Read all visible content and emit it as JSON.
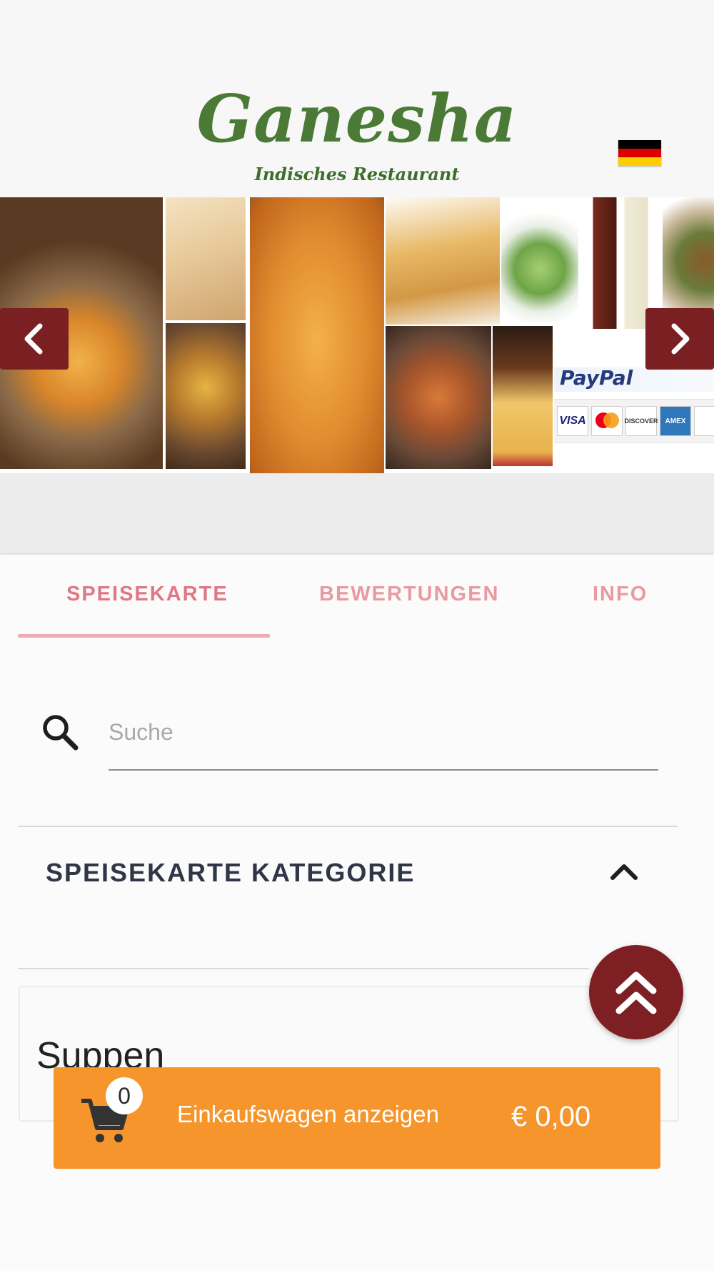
{
  "header": {
    "logo_title": "Ganesha",
    "logo_subtitle": "Indisches Restaurant",
    "language_flag": "german-flag-icon"
  },
  "banner": {
    "paypal_label": "PayPal",
    "card_labels": [
      "VISA",
      "MasterCard",
      "DISCOVER",
      "AMEX"
    ]
  },
  "tabs": [
    {
      "label": "SPEISEKARTE",
      "active": true
    },
    {
      "label": "BEWERTUNGEN",
      "active": false
    },
    {
      "label": "INFO",
      "active": false
    }
  ],
  "search": {
    "placeholder": "Suche",
    "value": ""
  },
  "category": {
    "title": "SPEISEKARTE KATEGORIE",
    "expanded": true
  },
  "section": {
    "title": "Suppen"
  },
  "cart": {
    "count": "0",
    "label": "Einkaufswagen anzeigen",
    "total": "€ 0,00"
  },
  "colors": {
    "brand_green": "#4a7a35",
    "arrow_maroon": "#7a1f22",
    "tab_pink": "#e07884",
    "cart_orange": "#f5952c"
  }
}
